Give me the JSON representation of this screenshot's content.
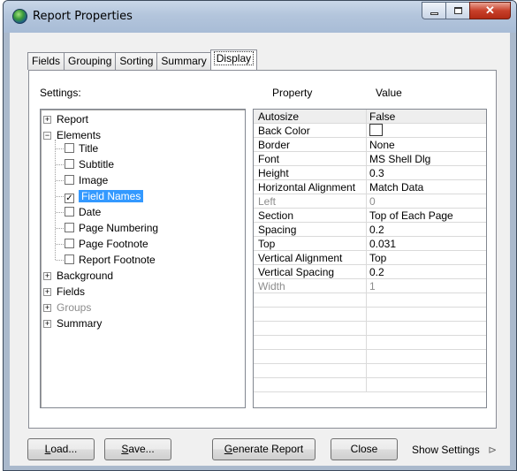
{
  "window": {
    "title": "Report Properties"
  },
  "tabs": [
    {
      "label": "Fields",
      "active": false
    },
    {
      "label": "Grouping",
      "active": false
    },
    {
      "label": "Sorting",
      "active": false
    },
    {
      "label": "Summary",
      "active": false
    },
    {
      "label": "Display",
      "active": true
    }
  ],
  "settings_label": "Settings:",
  "grid_headers": {
    "property": "Property",
    "value": "Value"
  },
  "tree": {
    "report": "Report",
    "elements": "Elements",
    "children": [
      {
        "label": "Title",
        "checked": false
      },
      {
        "label": "Subtitle",
        "checked": false
      },
      {
        "label": "Image",
        "checked": false
      },
      {
        "label": "Field Names",
        "checked": true,
        "selected": true
      },
      {
        "label": "Date",
        "checked": false
      },
      {
        "label": "Page Numbering",
        "checked": false
      },
      {
        "label": "Page Footnote",
        "checked": false
      },
      {
        "label": "Report Footnote",
        "checked": false
      }
    ],
    "background": "Background",
    "fields": "Fields",
    "groups": "Groups",
    "summary": "Summary"
  },
  "properties": [
    {
      "property": "Autosize",
      "value": "False",
      "disabled": false
    },
    {
      "property": "Back Color",
      "value": "",
      "disabled": false,
      "color_swatch": "#ffffff"
    },
    {
      "property": "Border",
      "value": "None",
      "disabled": false
    },
    {
      "property": "Font",
      "value": "MS Shell Dlg",
      "disabled": false
    },
    {
      "property": "Height",
      "value": "0.3",
      "disabled": false
    },
    {
      "property": "Horizontal Alignment",
      "value": "Match Data",
      "disabled": false
    },
    {
      "property": "Left",
      "value": "0",
      "disabled": true
    },
    {
      "property": "Section",
      "value": "Top of Each Page",
      "disabled": false
    },
    {
      "property": "Spacing",
      "value": "0.2",
      "disabled": false
    },
    {
      "property": "Top",
      "value": "0.031",
      "disabled": false
    },
    {
      "property": "Vertical Alignment",
      "value": "Top",
      "disabled": false
    },
    {
      "property": "Vertical Spacing",
      "value": "0.2",
      "disabled": false
    },
    {
      "property": "Width",
      "value": "1",
      "disabled": true
    }
  ],
  "buttons": {
    "load_mnemonic": "L",
    "load_rest": "oad...",
    "save_mnemonic": "S",
    "save_rest": "ave...",
    "generate_mnemonic": "G",
    "generate_rest": "enerate Report",
    "close": "Close",
    "show_settings": "Show Settings",
    "show_settings_arrow": "⊳"
  },
  "colors": {
    "selection": "#3399ff",
    "close_button": "#c8402a",
    "disabled_text": "#8c8c8c"
  }
}
